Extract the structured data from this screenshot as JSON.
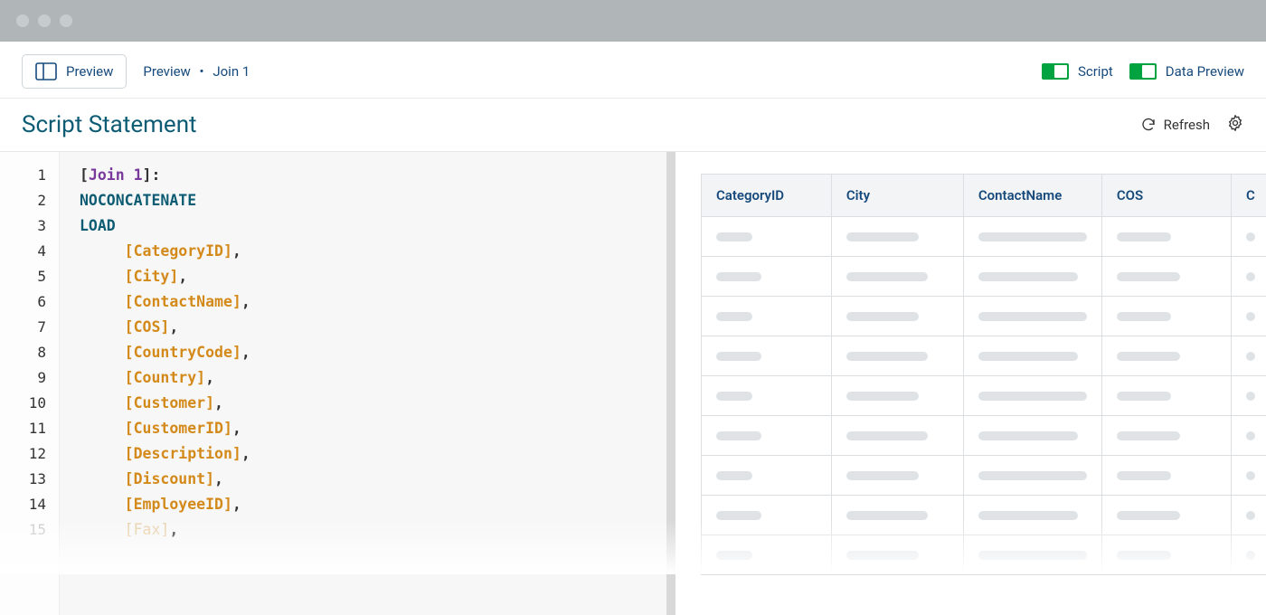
{
  "toolbar": {
    "preview_btn": "Preview",
    "breadcrumb": {
      "root": "Preview",
      "leaf": "Join 1"
    },
    "toggles": {
      "script": "Script",
      "data_preview": "Data Preview"
    }
  },
  "header": {
    "title": "Script Statement",
    "refresh": "Refresh"
  },
  "editor": {
    "table_label": "Join 1",
    "keywords": {
      "noconc": "NOCONCATENATE",
      "load": "LOAD"
    },
    "fields": [
      "CategoryID",
      "City",
      "ContactName",
      "COS",
      "CountryCode",
      "Country",
      "Customer",
      "CustomerID",
      "Description",
      "Discount",
      "EmployeeID",
      "Fax"
    ],
    "line_numbers": [
      "1",
      "2",
      "3",
      "4",
      "5",
      "6",
      "7",
      "8",
      "9",
      "10",
      "11",
      "12",
      "13",
      "14",
      "15"
    ]
  },
  "preview_table": {
    "columns": [
      "CategoryID",
      "City",
      "ContactName",
      "COS",
      "C"
    ],
    "row_count": 9
  }
}
